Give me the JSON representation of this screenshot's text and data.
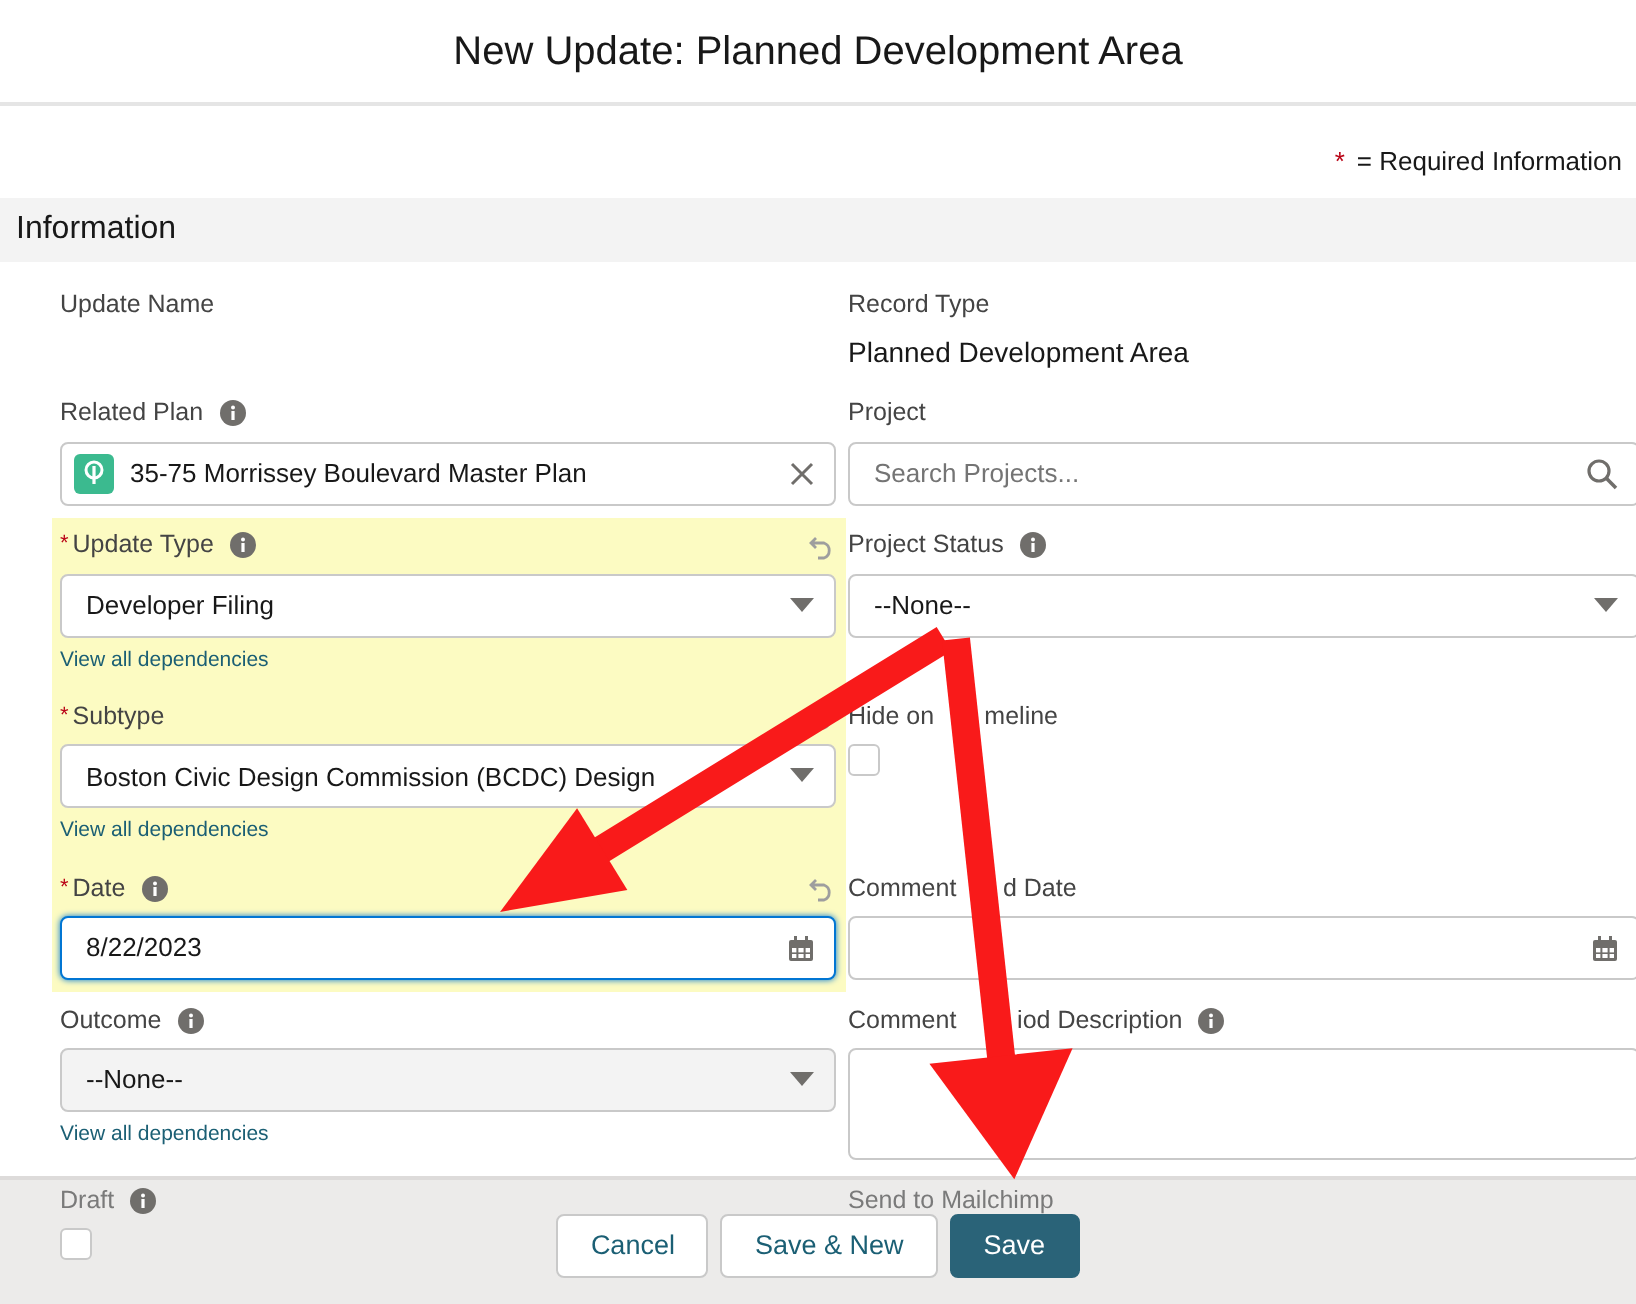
{
  "dialog": {
    "title": "New Update: Planned Development Area"
  },
  "required_note": {
    "marker": "*",
    "text": "= Required Information"
  },
  "section": {
    "title": "Information"
  },
  "rows": [
    [
      {
        "kind": "readonly",
        "label": [
          "Update Name"
        ]
      },
      {
        "kind": "readonly",
        "label": [
          "Record Type"
        ],
        "value": "Planned Development Area"
      }
    ],
    [
      {
        "kind": "lookup",
        "label": [
          "Related Plan"
        ],
        "info": true,
        "value": "35-75 Morrissey Boulevard Master Plan"
      },
      {
        "kind": "search",
        "label": [
          "Project"
        ],
        "placeholder": "Search Projects..."
      }
    ],
    [
      {
        "kind": "select",
        "required": true,
        "label": [
          "Update Type"
        ],
        "info": true,
        "changed": true,
        "value": "Developer Filing",
        "link": "View all dependencies"
      },
      {
        "kind": "select",
        "label": [
          "Project Status"
        ],
        "info": true,
        "value": "--None--"
      }
    ],
    [
      {
        "kind": "select",
        "required": true,
        "label": [
          "Subtype"
        ],
        "changed": true,
        "value": "Boston Civic Design Commission (BCDC) Design",
        "link": "View all dependencies"
      },
      {
        "kind": "checkbox",
        "label": [
          "Hide on",
          "meline"
        ],
        "checked": false
      }
    ],
    [
      {
        "kind": "date",
        "required": true,
        "label": [
          "Date"
        ],
        "info": true,
        "changed": true,
        "focused": true,
        "value": "8/22/2023"
      },
      {
        "kind": "date",
        "label": [
          "Comment",
          "d Date"
        ]
      }
    ],
    [
      {
        "kind": "select",
        "label": [
          "Outcome"
        ],
        "info": true,
        "disabled": true,
        "value": "--None--",
        "link": "View all dependencies"
      },
      {
        "kind": "textarea",
        "label": [
          "Comment",
          "iod Description"
        ],
        "info": true
      }
    ],
    [
      {
        "kind": "checkbox",
        "label": [
          "Draft"
        ],
        "info": true,
        "checked": false
      },
      {
        "kind": "label",
        "label": [
          "Send to Mailchimp"
        ]
      }
    ]
  ],
  "buttons": [
    {
      "label": "Cancel",
      "primary": false
    },
    {
      "label": "Save & New",
      "primary": false
    },
    {
      "label": "Save",
      "primary": true
    }
  ]
}
